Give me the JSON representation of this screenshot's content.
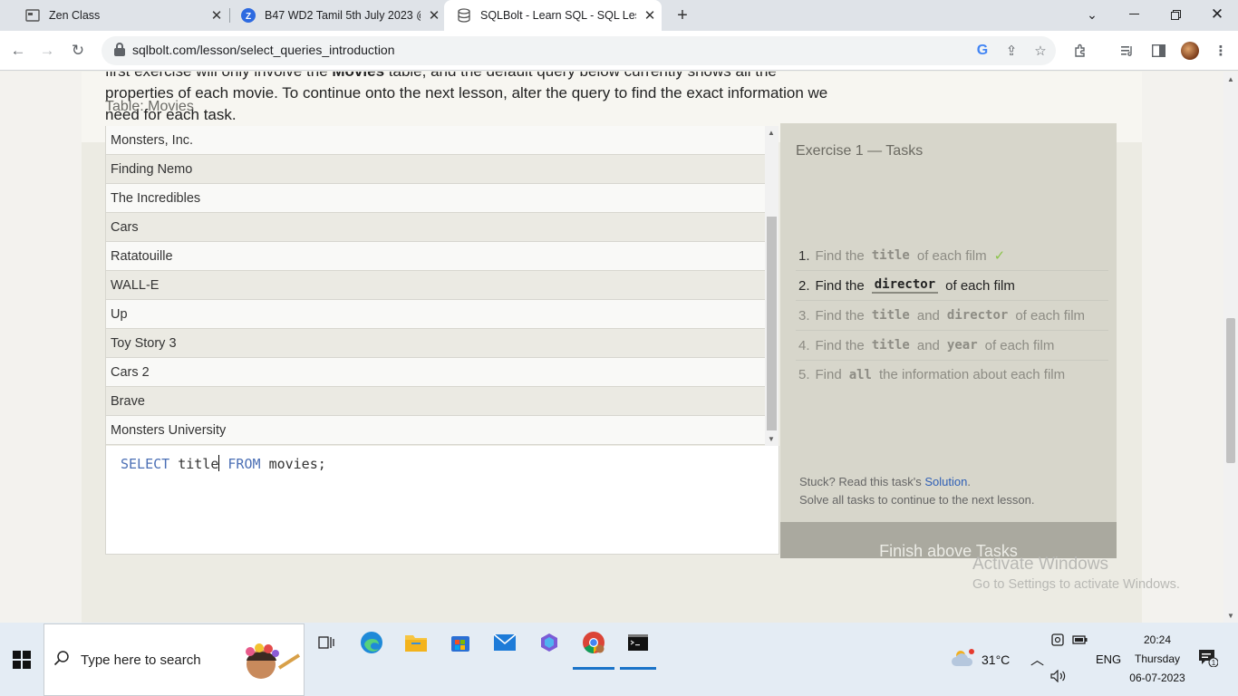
{
  "browser": {
    "tabs": [
      {
        "title": "Zen Class",
        "active": false
      },
      {
        "title": "B47 WD2 Tamil 5th July 2023 @",
        "active": false
      },
      {
        "title": "SQLBolt - Learn SQL - SQL Less",
        "active": true
      }
    ],
    "url": "sqlbolt.com/lesson/select_queries_introduction"
  },
  "lesson": {
    "intro_line0_prefix": "first exercise will only involve the",
    "intro_line0_bold": "Movies",
    "intro_line0_suffix": "table, and the default query below currently shows all the",
    "intro_line1": "properties of each movie. To continue onto the next lesson, alter the query to find the exact information we",
    "intro_line2": "need for each task."
  },
  "table": {
    "label": "Table: Movies",
    "rows": [
      "Monsters, Inc.",
      "Finding Nemo",
      "The Incredibles",
      "Cars",
      "Ratatouille",
      "WALL-E",
      "Up",
      "Toy Story 3",
      "Cars 2",
      "Brave",
      "Monsters University"
    ]
  },
  "query": {
    "select": "SELECT",
    "column": "title",
    "from": "FROM",
    "rest": "movies;"
  },
  "tasks": {
    "title": "Exercise 1 — Tasks",
    "items": [
      {
        "num": "1.",
        "pre": "Find the",
        "code1": "title",
        "mid": "",
        "code2": "",
        "post": "of each film",
        "state": "done",
        "check": "✓"
      },
      {
        "num": "2.",
        "pre": "Find the",
        "code1": "director",
        "mid": "",
        "code2": "",
        "post": "of each film",
        "state": "current"
      },
      {
        "num": "3.",
        "pre": "Find the",
        "code1": "title",
        "mid": "and",
        "code2": "director",
        "post": "of each film",
        "state": "todo"
      },
      {
        "num": "4.",
        "pre": "Find the",
        "code1": "title",
        "mid": "and",
        "code2": "year",
        "post": "of each film",
        "state": "todo"
      },
      {
        "num": "5.",
        "pre": "Find",
        "code1": "all",
        "mid": "",
        "code2": "",
        "post": "the information about each film",
        "state": "todo"
      }
    ],
    "stuck_prefix": "Stuck? Read this task's",
    "stuck_link": "Solution",
    "stuck_suffix": ".",
    "solve_all": "Solve all tasks to continue to the next lesson.",
    "finish_label": "Finish above Tasks"
  },
  "watermark": {
    "title": "Activate Windows",
    "sub": "Go to Settings to activate Windows."
  },
  "taskbar": {
    "search_placeholder": "Type here to search",
    "weather": "31°C",
    "lang": "ENG",
    "time": "20:24",
    "day": "Thursday",
    "date": "06-07-2023",
    "notif_count": "1"
  }
}
